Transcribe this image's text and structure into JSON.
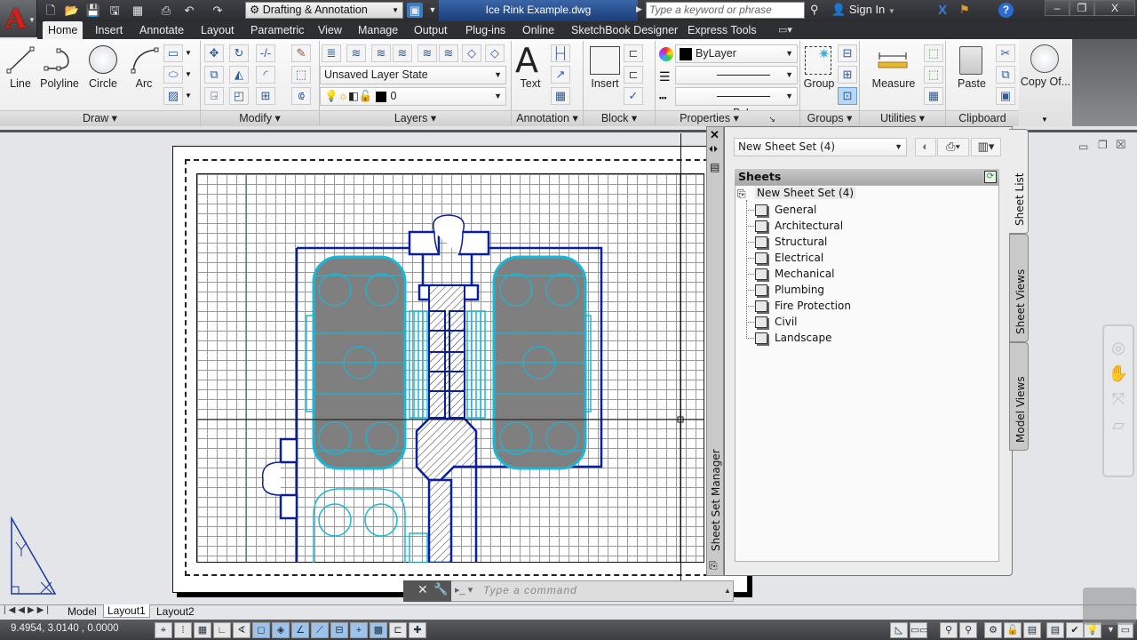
{
  "app": {
    "file_title": "Ice Rink Example.dwg",
    "workspace": "Drafting & Annotation",
    "search_placeholder": "Type a keyword or phrase",
    "sign_in": "Sign In",
    "logo_letter": "A"
  },
  "quick_access": [
    "new-icon",
    "open-icon",
    "save-icon",
    "saveas-icon",
    "plot-preview-icon",
    "print-icon",
    "undo-icon",
    "redo-icon"
  ],
  "tabs": [
    {
      "label": "Home",
      "active": true
    },
    {
      "label": "Insert"
    },
    {
      "label": "Annotate"
    },
    {
      "label": "Layout"
    },
    {
      "label": "Parametric"
    },
    {
      "label": "View"
    },
    {
      "label": "Manage"
    },
    {
      "label": "Output"
    },
    {
      "label": "Plug-ins"
    },
    {
      "label": "Online"
    },
    {
      "label": "SketchBook Designer"
    },
    {
      "label": "Express Tools"
    }
  ],
  "ribbon": {
    "draw": {
      "title": "Draw",
      "line": "Line",
      "polyline": "Polyline",
      "circle": "Circle",
      "arc": "Arc"
    },
    "modify": {
      "title": "Modify"
    },
    "layers": {
      "title": "Layers",
      "layer_state": "Unsaved Layer State",
      "current_layer": "0"
    },
    "annotation": {
      "title": "Annotation",
      "text": "Text"
    },
    "block": {
      "title": "Block",
      "insert": "Insert"
    },
    "properties": {
      "title": "Properties",
      "color": "ByLayer",
      "linetype": "ByLayer",
      "lineweight": "ByLayer"
    },
    "groups": {
      "title": "Groups",
      "group": "Group"
    },
    "utilities": {
      "title": "Utilities",
      "measure": "Measure"
    },
    "clipboard": {
      "title": "Clipboard",
      "paste": "Paste"
    },
    "view": {
      "copy_of": "Copy Of..."
    }
  },
  "sheet_set_manager": {
    "title": "Sheet Set Manager",
    "selected_set": "New Sheet Set (4)",
    "sheets_header": "Sheets",
    "root": "New Sheet Set (4)",
    "sheets": [
      "General",
      "Architectural",
      "Structural",
      "Electrical",
      "Mechanical",
      "Plumbing",
      "Fire Protection",
      "Civil",
      "Landscape"
    ],
    "tabs": [
      "Sheet List",
      "Sheet Views",
      "Model Views"
    ]
  },
  "command_line": {
    "placeholder": "Type a command"
  },
  "layout_tabs": [
    {
      "label": "Model"
    },
    {
      "label": "Layout1",
      "active": true
    },
    {
      "label": "Layout2"
    }
  ],
  "status": {
    "coordinates": "9.4954, 3.0140 , 0.0000"
  },
  "colors": {
    "accent": "#1c3d78",
    "drawing_blue": "#0a1fa0",
    "drawing_cyan": "#19b8d8",
    "rink_fill": "#7f7f7f"
  }
}
